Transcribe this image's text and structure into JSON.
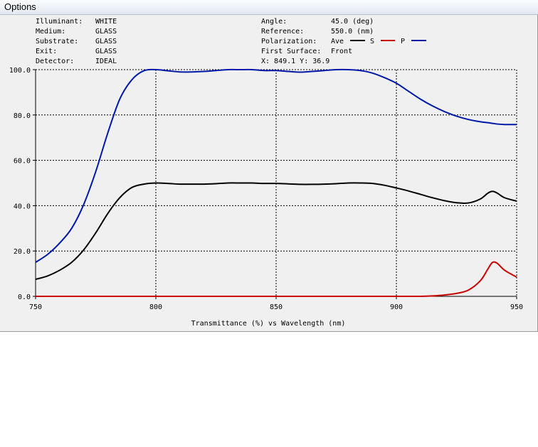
{
  "menu": {
    "options_label": "Options"
  },
  "info_left": [
    {
      "label": "Illuminant:",
      "value": "WHITE"
    },
    {
      "label": "Medium:",
      "value": "GLASS"
    },
    {
      "label": "Substrate:",
      "value": "GLASS"
    },
    {
      "label": "Exit:",
      "value": "GLASS"
    },
    {
      "label": "Detector:",
      "value": "IDEAL"
    }
  ],
  "info_right": {
    "angle_label": "Angle:",
    "angle_value": "45.0 (deg)",
    "reference_label": "Reference:",
    "reference_value": "550.0 (nm)",
    "polarization_label": "Polarization:",
    "pol_ave": "Ave",
    "pol_s": "S",
    "pol_p": "P",
    "first_surface_label": "First Surface:",
    "first_surface_value": "Front",
    "cursor_readout": "X: 849.1  Y:  36.9"
  },
  "colors": {
    "ave": "#000000",
    "s": "#cc0000",
    "p": "#0018a8",
    "grid": "#000000",
    "background": "#f0f0f0"
  },
  "chart_data": {
    "type": "line",
    "xlabel": "Transmittance (%)  vs  Wavelength (nm)",
    "xlim": [
      750,
      950
    ],
    "ylim": [
      0,
      100
    ],
    "xticks": [
      "750",
      "800",
      "850",
      "900",
      "950"
    ],
    "yticks": [
      "0.0",
      "20.0",
      "40.0",
      "60.0",
      "80.0",
      "100.0"
    ],
    "grid": true,
    "legend_position": "top-right",
    "x": [
      750,
      755,
      760,
      765,
      770,
      775,
      780,
      785,
      790,
      795,
      800,
      805,
      810,
      815,
      820,
      825,
      830,
      835,
      840,
      845,
      850,
      855,
      860,
      865,
      870,
      875,
      880,
      885,
      890,
      895,
      900,
      905,
      910,
      915,
      920,
      925,
      930,
      935,
      938,
      940,
      942,
      945,
      950
    ],
    "series": [
      {
        "name": "Ave",
        "color": "#000000",
        "values": [
          7.5,
          9,
          11.5,
          15,
          20.5,
          28,
          36.5,
          43.5,
          48,
          49.5,
          50,
          49.8,
          49.5,
          49.5,
          49.5,
          49.7,
          50,
          50,
          50,
          49.8,
          49.8,
          49.6,
          49.4,
          49.4,
          49.5,
          49.7,
          50,
          50,
          49.8,
          49,
          47.8,
          46.5,
          45,
          43.5,
          42.2,
          41.3,
          41.2,
          43,
          45.5,
          46.3,
          45.5,
          43.5,
          42
        ]
      },
      {
        "name": "S",
        "color": "#cc0000",
        "values": [
          0,
          0,
          0,
          0,
          0,
          0,
          0,
          0,
          0,
          0,
          0,
          0,
          0,
          0,
          0,
          0,
          0,
          0,
          0,
          0,
          0,
          0,
          0,
          0,
          0,
          0,
          0,
          0,
          0,
          0,
          0,
          0,
          0,
          0.2,
          0.6,
          1.3,
          2.8,
          7,
          12,
          15,
          14.5,
          11.5,
          8.5
        ]
      },
      {
        "name": "P",
        "color": "#0018a8",
        "values": [
          15,
          18.5,
          23.5,
          30,
          40.5,
          55,
          72,
          87,
          95.5,
          99.5,
          100,
          99.5,
          99,
          99,
          99.2,
          99.6,
          100,
          100,
          100,
          99.6,
          99.6,
          99.2,
          98.9,
          99.2,
          99.6,
          100,
          100,
          99.6,
          98.5,
          96.5,
          94,
          90.5,
          87,
          84,
          81.5,
          79.5,
          78,
          77,
          76.6,
          76.3,
          76,
          75.8,
          75.8
        ]
      }
    ]
  }
}
